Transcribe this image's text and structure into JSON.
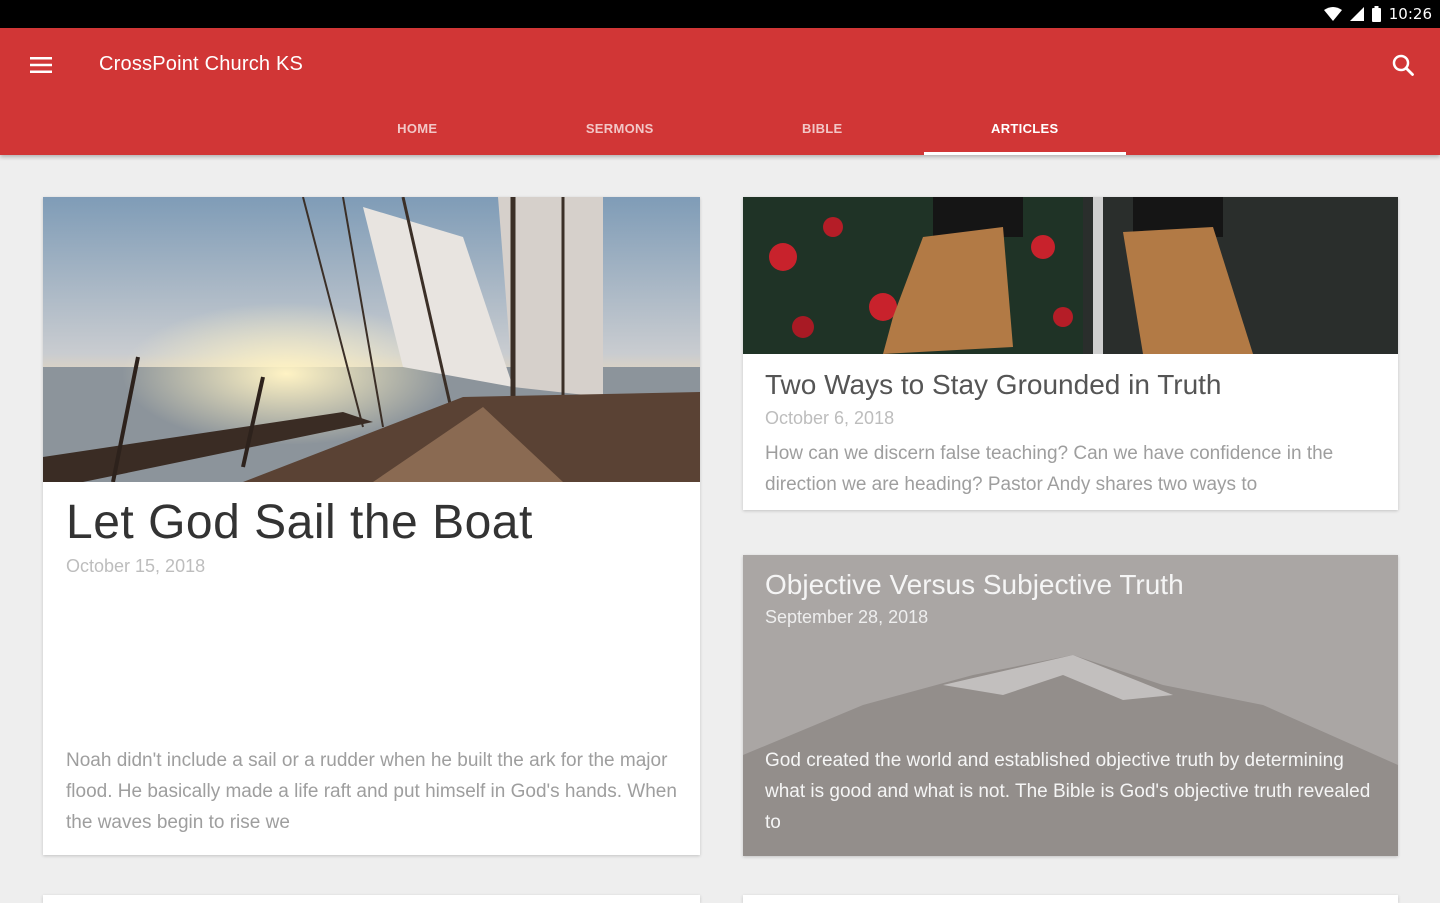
{
  "status_bar": {
    "time": "10:26"
  },
  "app_bar": {
    "title": "CrossPoint Church KS"
  },
  "tabs": [
    {
      "label": "HOME",
      "active": false
    },
    {
      "label": "SERMONS",
      "active": false
    },
    {
      "label": "BIBLE",
      "active": false
    },
    {
      "label": "ARTICLES",
      "active": true
    }
  ],
  "articles": [
    {
      "title": "Let God Sail the Boat",
      "date": "October 15, 2018",
      "excerpt": "Noah didn't include a sail or a rudder when he built the ark for the major flood. He basically made a life raft and put himself in God's hands. When the waves begin to rise we"
    },
    {
      "title": "Two Ways to Stay Grounded in Truth",
      "date": "October 6, 2018",
      "excerpt": "How can we discern false teaching? Can we have confidence in the direction we are heading? Pastor Andy shares two ways to"
    },
    {
      "title": "Objective Versus Subjective Truth",
      "date": "September 28, 2018",
      "excerpt": "God created the world and established objective truth by determining what is good and what is not. The Bible is God's objective truth revealed to"
    }
  ],
  "colors": {
    "app_bar": "#d13636",
    "background": "#eeeeee"
  }
}
